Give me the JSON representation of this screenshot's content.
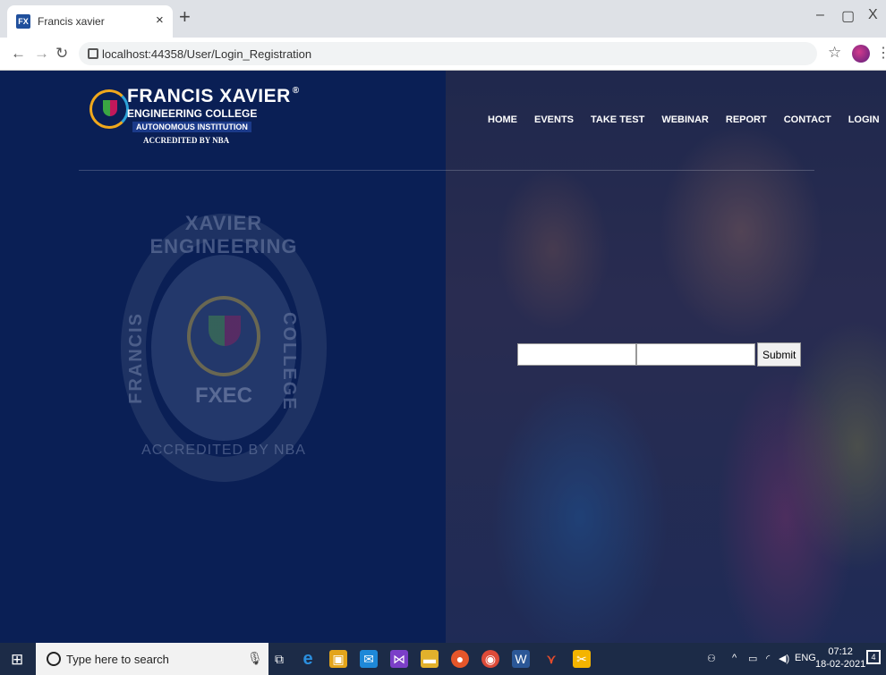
{
  "browser": {
    "tab_favicon": "FX",
    "tab_title": "Francis xavier",
    "tab_close": "×",
    "new_tab": "+",
    "url": "localhost:44358/User/Login_Registration",
    "win_minimize": "–",
    "win_restore": "▢",
    "win_close": "X"
  },
  "logo": {
    "title": "FRANCIS XAVIER",
    "registered": "®",
    "line1": "ENGINEERING COLLEGE",
    "line2": "AUTONOMOUS INSTITUTION",
    "line3": "ACCREDITED BY NBA"
  },
  "nav": {
    "items": [
      "HOME",
      "EVENTS",
      "TAKE TEST",
      "WEBINAR",
      "REPORT",
      "CONTACT",
      "LOGIN"
    ]
  },
  "seal": {
    "top_text": "XAVIER ENGINEERING",
    "left_text": "FRANCIS",
    "right_text": "COLLEGE",
    "center_text": "FXEC",
    "bottom_text": "ACCREDITED BY NBA"
  },
  "form": {
    "field1_value": "",
    "field2_value": "",
    "submit_label": "Submit"
  },
  "taskbar": {
    "search_placeholder": "Type here to search",
    "tray_text": "ENG",
    "time": "07:12",
    "date": "18-02-2021",
    "notifications": "4"
  },
  "colors": {
    "page_bg": "#0a1f55",
    "taskbar_bg": "#1c2b47",
    "accent_orange": "#f0a81c"
  }
}
